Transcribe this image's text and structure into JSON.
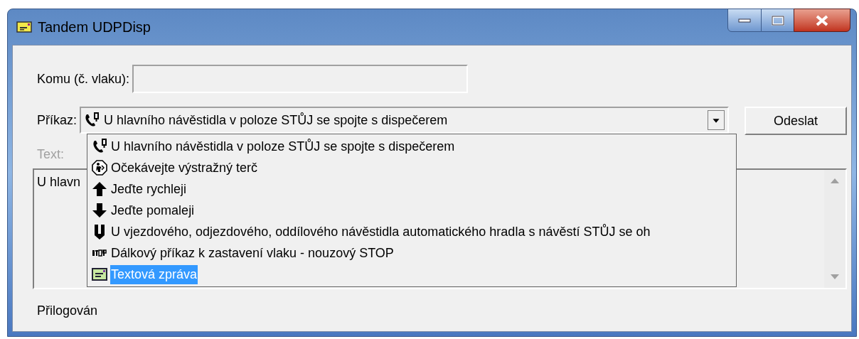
{
  "window": {
    "title": "Tandem UDPDisp"
  },
  "recipient": {
    "label": "Komu (č. vlaku):"
  },
  "command": {
    "label": "Příkaz:",
    "current": {
      "kind": "phone",
      "label": "U hlavního návěstidla v poloze STŮJ se spojte s dispečerem"
    },
    "expanded": true,
    "options": [
      {
        "kind": "phone",
        "label": "U hlavního návěstidla v poloze STŮJ se spojte s dispečerem",
        "selected": false
      },
      {
        "kind": "warning",
        "label": "Očekávejte výstražný terč",
        "selected": false
      },
      {
        "kind": "up",
        "label": "Jeďte rychleji",
        "selected": false
      },
      {
        "kind": "down",
        "label": "Jeďte pomaleji",
        "selected": false
      },
      {
        "kind": "signal",
        "label": "U vjezdového, odjezdového, oddílového návěstidla automatického hradla s návěstí STŮJ se oh",
        "selected": false
      },
      {
        "kind": "stop",
        "label": "Dálkový příkaz k zastavení vlaku - nouzový STOP",
        "selected": false
      },
      {
        "kind": "message",
        "label": "Textová zpráva",
        "selected": true
      }
    ]
  },
  "send_button": "Odeslat",
  "text": {
    "label": "Text:",
    "disabled": true,
    "value": "U hlavn"
  },
  "status": "Přilogován"
}
